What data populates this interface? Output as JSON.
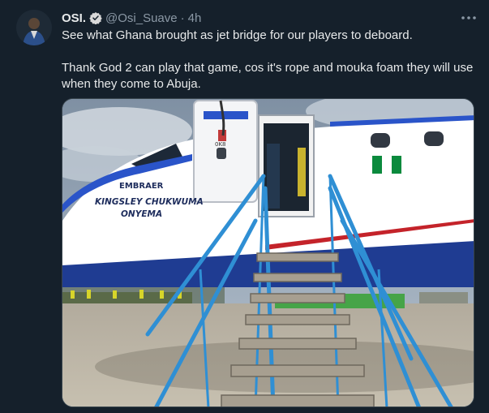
{
  "tweet": {
    "author_name": "OSI.",
    "handle": "@Osi_Suave",
    "separator": "·",
    "time": "4h",
    "line1": "See what Ghana brought as jet bridge for our players to deboard.",
    "line2": "Thank God 2 can play that game, cos it's rope and mouka foam they will use when they come to Abuja."
  },
  "photo": {
    "brand_text": "EMBRAER",
    "aircraft_name_line1": "KINGSLEY CHUKWUMA",
    "aircraft_name_line2": "ONYEMA",
    "door_marking": "0K8"
  },
  "icons": {
    "verified": "verified-badge-icon",
    "more": "more-options-icon"
  },
  "colors": {
    "background": "#15202b",
    "text_primary": "#e7e9ea",
    "text_secondary": "#8b98a5",
    "verified": "#1d9bf0"
  }
}
